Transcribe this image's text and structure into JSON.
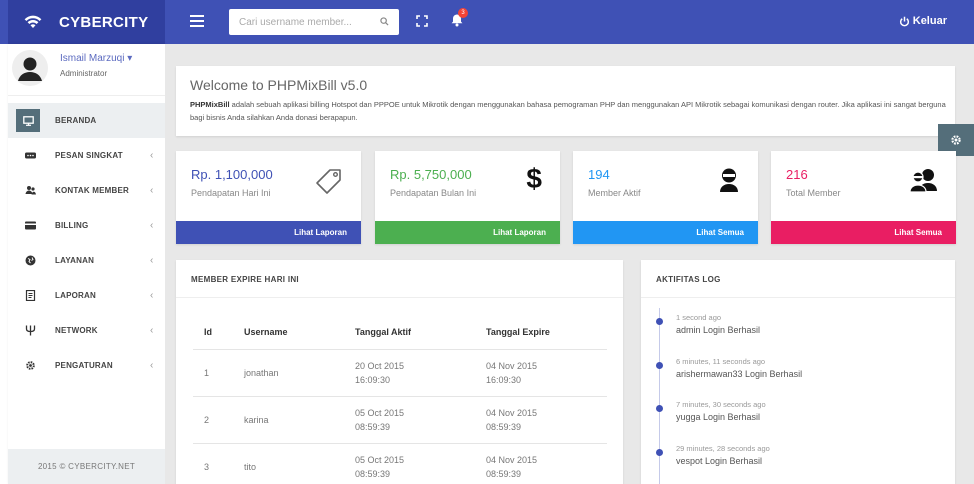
{
  "brand": {
    "name": "CYBERCITY"
  },
  "topbar": {
    "search_placeholder": "Cari username member...",
    "notification_count": "3",
    "logout_label": "Keluar"
  },
  "user": {
    "name": "Ismail Marzuqi",
    "role": "Administrator"
  },
  "sidebar": {
    "items": [
      {
        "label": "BERANDA",
        "icon": "monitor-icon",
        "active": true
      },
      {
        "label": "PESAN SINGKAT",
        "icon": "sms-icon",
        "chevron": "‹"
      },
      {
        "label": "KONTAK MEMBER",
        "icon": "users-icon",
        "chevron": "‹"
      },
      {
        "label": "BILLING",
        "icon": "credit-card-icon",
        "chevron": "‹"
      },
      {
        "label": "LAYANAN",
        "icon": "globe-icon",
        "chevron": "‹"
      },
      {
        "label": "LAPORAN",
        "icon": "report-icon",
        "chevron": "‹"
      },
      {
        "label": "NETWORK",
        "icon": "network-icon",
        "chevron": "‹"
      },
      {
        "label": "PENGATURAN",
        "icon": "gear-icon",
        "chevron": "‹"
      }
    ],
    "footer": "2015 © CYBERCITY.NET"
  },
  "welcome": {
    "title": "Welcome to PHPMixBill v5.0",
    "app_name": "PHPMixBill",
    "body": " adalah sebuah aplikasi billing Hotspot dan PPPOE untuk Mikrotik dengan menggunakan bahasa pemograman PHP dan menggunakan API Mikrotik sebagai komunikasi dengan router. Jika aplikasi ini sangat berguna bagi bisnis Anda silahkan Anda donasi berapapun."
  },
  "stats": [
    {
      "value": "Rp. 1,100,000",
      "label": "Pendapatan Hari Ini",
      "button": "Lihat Laporan",
      "color": "#3f51b5",
      "value_color": "#3f51b5",
      "icon": "tag-icon"
    },
    {
      "value": "Rp. 5,750,000",
      "label": "Pendapatan Bulan Ini",
      "button": "Lihat Laporan",
      "color": "#4caf50",
      "value_color": "#4caf50",
      "icon": "dollar-icon"
    },
    {
      "value": "194",
      "label": "Member Aktif",
      "button": "Lihat Semua",
      "color": "#2196f3",
      "value_color": "#2196f3",
      "icon": "user-icon"
    },
    {
      "value": "216",
      "label": "Total Member",
      "button": "Lihat Semua",
      "color": "#e91e63",
      "value_color": "#e91e63",
      "icon": "users-group-icon"
    }
  ],
  "members_panel": {
    "title": "MEMBER EXPIRE HARI INI",
    "headers": [
      "Id",
      "Username",
      "Tanggal Aktif",
      "Tanggal Expire"
    ],
    "rows": [
      {
        "id": "1",
        "username": "jonathan",
        "active_date": "20 Oct 2015",
        "active_time": "16:09:30",
        "expire_date": "04 Nov 2015",
        "expire_time": "16:09:30"
      },
      {
        "id": "2",
        "username": "karina",
        "active_date": "05 Oct 2015",
        "active_time": "08:59:39",
        "expire_date": "04 Nov 2015",
        "expire_time": "08:59:39"
      },
      {
        "id": "3",
        "username": "tito",
        "active_date": "05 Oct 2015",
        "active_time": "08:59:39",
        "expire_date": "04 Nov 2015",
        "expire_time": "08:59:39"
      }
    ]
  },
  "log_panel": {
    "title": "AKTIFITAS LOG",
    "entries": [
      {
        "time": "1 second ago",
        "message": "admin Login Berhasil"
      },
      {
        "time": "6 minutes, 11 seconds ago",
        "message": "arishermawan33 Login Berhasil"
      },
      {
        "time": "7 minutes, 30 seconds ago",
        "message": "yugga Login Berhasil"
      },
      {
        "time": "29 minutes, 28 seconds ago",
        "message": "vespot Login Berhasil"
      }
    ]
  }
}
